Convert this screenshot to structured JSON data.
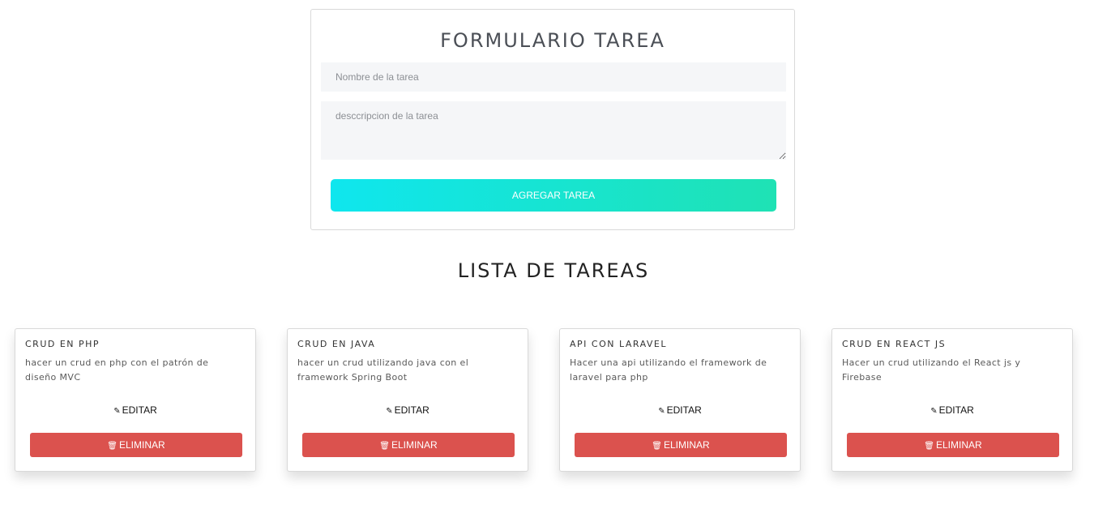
{
  "form": {
    "title": "FORMULARIO TAREA",
    "name_placeholder": "Nombre de la tarea",
    "desc_placeholder": "desccripcion de la tarea",
    "submit_label": "AGREGAR TAREA"
  },
  "list": {
    "title": "LISTA DE TAREAS",
    "edit_label": "EDITAR",
    "delete_label": "ELIMINAR",
    "edit_icon": "edit-icon",
    "delete_icon": "trash-icon",
    "tasks": [
      {
        "name": "CRUD EN PHP",
        "description": "hacer un crud en php con el patrón de diseño MVC"
      },
      {
        "name": "CRUD EN JAVA",
        "description": "hacer un crud utilizando java con el framework Spring Boot"
      },
      {
        "name": "API CON LARAVEL",
        "description": "Hacer una api utilizando el framework de laravel para php"
      },
      {
        "name": "CRUD EN REACT JS",
        "description": "Hacer un crud utilizando el React js y Firebase"
      }
    ]
  },
  "colors": {
    "button_gradient_start": "#0fe6ee",
    "button_gradient_end": "#1fe2b4",
    "delete_button": "#db524e",
    "input_background": "#f5f6f8"
  }
}
